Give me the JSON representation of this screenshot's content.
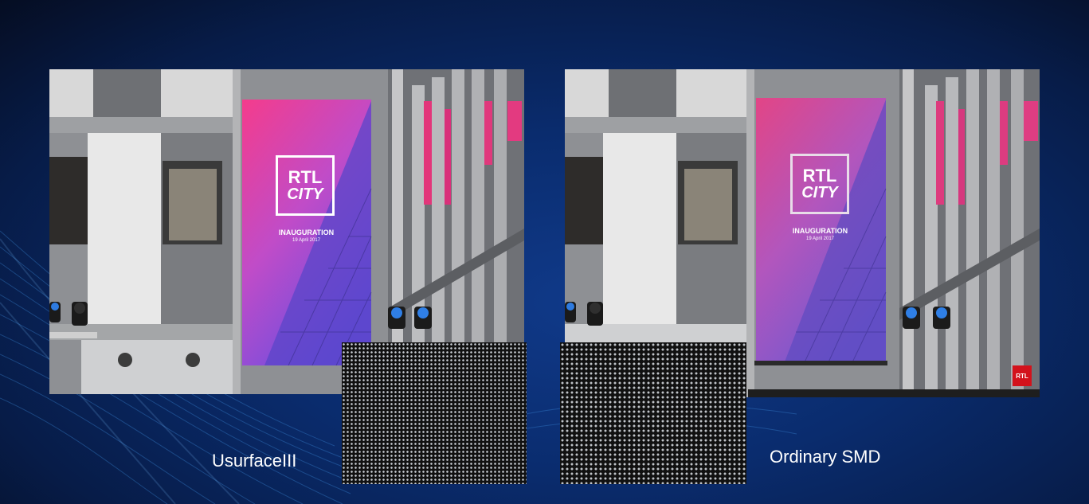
{
  "left": {
    "caption": "UsurfaceIII",
    "screen": {
      "logo_line1": "RTL",
      "logo_line2": "CITY",
      "headline": "INAUGURATION",
      "date": "19 April 2017"
    }
  },
  "right": {
    "caption": "Ordinary SMD",
    "screen": {
      "logo_line1": "RTL",
      "logo_line2": "CITY",
      "headline": "INAUGURATION",
      "date": "19 April 2017"
    },
    "badge": "RTL"
  },
  "colors": {
    "background": "#0a2c6e",
    "screen_pink": "#f23a8e",
    "screen_purple": "#8a4fd8",
    "badge_red": "#d3121c"
  }
}
